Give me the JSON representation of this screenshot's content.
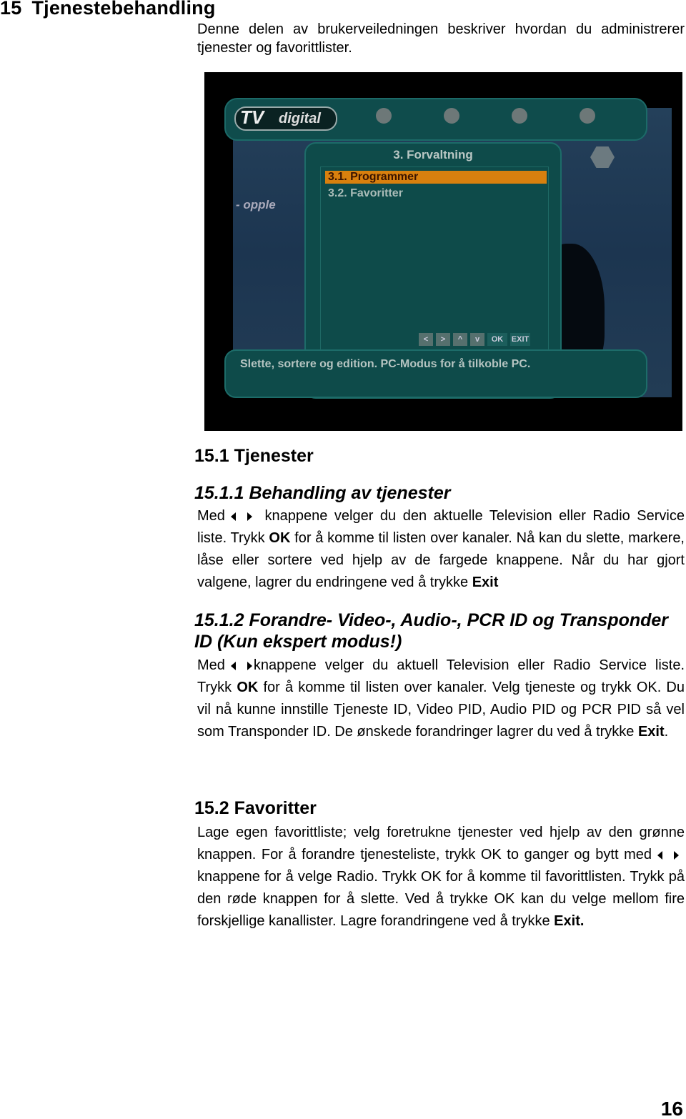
{
  "chapter": {
    "number": "15",
    "title": "Tjenestebehandling"
  },
  "intro": "Denne delen av brukerveiledningen beskriver hvordan du administrerer tjenester og favorittlister.",
  "screenshot": {
    "logo": {
      "tv": "TV",
      "text": "digital"
    },
    "menu_title": "3.  Forvaltning",
    "items": [
      "3.1.  Programmer",
      "3.2.  Favoritter"
    ],
    "side_text": "- opple",
    "buttons": [
      "<",
      ">",
      "^",
      "v",
      "OK",
      "EXIT"
    ],
    "help_text": "Slette, sortere og  edition. PC-Modus for å tilkoble PC.",
    "highlight_color": "#d8800e"
  },
  "s15_1": {
    "title": "15.1 Tjenester"
  },
  "s15_1_1": {
    "title": "15.1.1 Behandling av tjenester",
    "p": [
      "Med",
      " knappene velger du den aktuelle Television eller Radio Service liste. Trykk ",
      "OK",
      " for å komme til listen over kanaler. Nå kan du slette, markere, låse eller sortere ved hjelp av de fargede knappene. Når du har gjort valgene, lagrer du endringene ved å trykke ",
      "Exit"
    ]
  },
  "s15_1_2": {
    "title": "15.1.2 Forandre- Video-, Audio-, PCR ID og Transponder ID (Kun ekspert modus!)",
    "p": [
      "Med",
      "knappene velger du aktuell Television eller Radio Service liste. Trykk ",
      "OK",
      " for å komme til listen over kanaler. Velg tjeneste og trykk OK. Du vil nå kunne innstille Tjeneste ID, Video PID, Audio PID og PCR PID så vel som Transponder ID. De ønskede forandringer lagrer du ved å trykke ",
      "Exit",
      "."
    ]
  },
  "s15_2": {
    "title": "15.2 Favoritter",
    "p": [
      "Lage egen favorittliste; velg foretrukne tjenester ved hjelp av den grønne knappen. For å forandre tjenesteliste, trykk OK to ganger og bytt med",
      " knappene for å velge Radio. Trykk OK for å komme til favorittlisten. Trykk på den røde knappen for å slette. Ved å trykke OK kan du velge mellom fire forskjellige kanallister. Lagre forandringene ved å trykke ",
      "Exit."
    ]
  },
  "icons": {
    "left": "triangle-left-icon",
    "right": "triangle-right-icon"
  },
  "page_number": "16"
}
